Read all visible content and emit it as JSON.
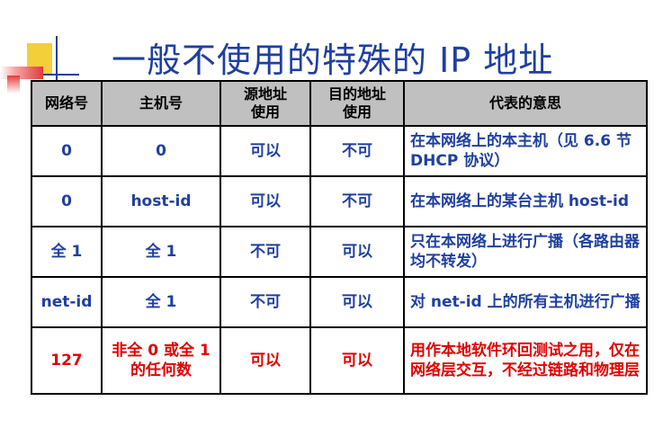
{
  "title": "一般不使用的特殊的 IP 地址",
  "table": {
    "headers": [
      "网络号",
      "主机号",
      "源地址\n使用",
      "目的地址\n使用",
      "代表的意思"
    ],
    "rows": [
      {
        "net": "0",
        "host": "0",
        "src": "可以",
        "dst": "不可",
        "meaning": "在本网络上的本主机（见 6.6 节 DHCP 协议）"
      },
      {
        "net": "0",
        "host": "host-id",
        "src": "可以",
        "dst": "不可",
        "meaning": "在本网络上的某台主机 host-id"
      },
      {
        "net": "全 1",
        "host": "全 1",
        "src": "不可",
        "dst": "可以",
        "meaning": "只在本网络上进行广播（各路由器均不转发）"
      },
      {
        "net": "net-id",
        "host": "全 1",
        "src": "不可",
        "dst": "可以",
        "meaning": "对 net-id 上的所有主机进行广播"
      },
      {
        "net": "127",
        "host": "非全 0 或全 1 的任何数",
        "src": "可以",
        "dst": "可以",
        "meaning": "用作本地软件环回测试之用，仅在网络层交互，不经过链路和物理层"
      }
    ]
  },
  "colors": {
    "title": "#1f3fa0",
    "body_text": "#1f3fa0",
    "highlight_text": "#e00000",
    "header_bg": "#c0c0c0"
  }
}
